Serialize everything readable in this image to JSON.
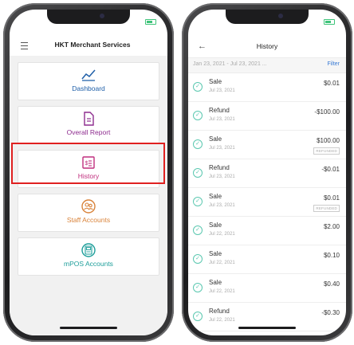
{
  "left_phone": {
    "header": {
      "title": "HKT Merchant Services"
    },
    "menu": [
      {
        "id": "dashboard",
        "label": "Dashboard",
        "icon": "chart-line-icon",
        "color": "#1f5fa8"
      },
      {
        "id": "overall-report",
        "label": "Overall Report",
        "icon": "document-icon",
        "color": "#8e2d8f"
      },
      {
        "id": "history",
        "label": "History",
        "icon": "receipt-icon",
        "color": "#c02f7e",
        "selected": true
      },
      {
        "id": "staff-accounts",
        "label": "Staff Accounts",
        "icon": "staff-icon",
        "color": "#d9833a"
      },
      {
        "id": "mpos-accounts",
        "label": "mPOS Accounts",
        "icon": "pos-terminal-icon",
        "color": "#1d9e9a"
      }
    ]
  },
  "right_phone": {
    "header": {
      "title": "History",
      "back_icon": "back-arrow-icon"
    },
    "filter": {
      "date_range": "Jan 23, 2021 - Jul 23, 2021 ...",
      "filter_label": "Filter"
    },
    "transactions": [
      {
        "type": "Sale",
        "date": "Jul 23, 2021",
        "amount": "$0.01",
        "badge": ""
      },
      {
        "type": "Refund",
        "date": "Jul 23, 2021",
        "amount": "-$100.00",
        "badge": ""
      },
      {
        "type": "Sale",
        "date": "Jul 23, 2021",
        "amount": "$100.00",
        "badge": "REFUNDED"
      },
      {
        "type": "Refund",
        "date": "Jul 23, 2021",
        "amount": "-$0.01",
        "badge": ""
      },
      {
        "type": "Sale",
        "date": "Jul 23, 2021",
        "amount": "$0.01",
        "badge": "REFUNDED"
      },
      {
        "type": "Sale",
        "date": "Jul 22, 2021",
        "amount": "$2.00",
        "badge": ""
      },
      {
        "type": "Sale",
        "date": "Jul 22, 2021",
        "amount": "$0.10",
        "badge": ""
      },
      {
        "type": "Sale",
        "date": "Jul 22, 2021",
        "amount": "$0.40",
        "badge": ""
      },
      {
        "type": "Refund",
        "date": "Jul 22, 2021",
        "amount": "-$0.30",
        "badge": ""
      }
    ],
    "status_icon": "check-circle-icon"
  },
  "colors": {
    "accent_blue": "#3a7bd5",
    "highlight_red": "#e02020",
    "check_teal": "#5bc8b0"
  }
}
